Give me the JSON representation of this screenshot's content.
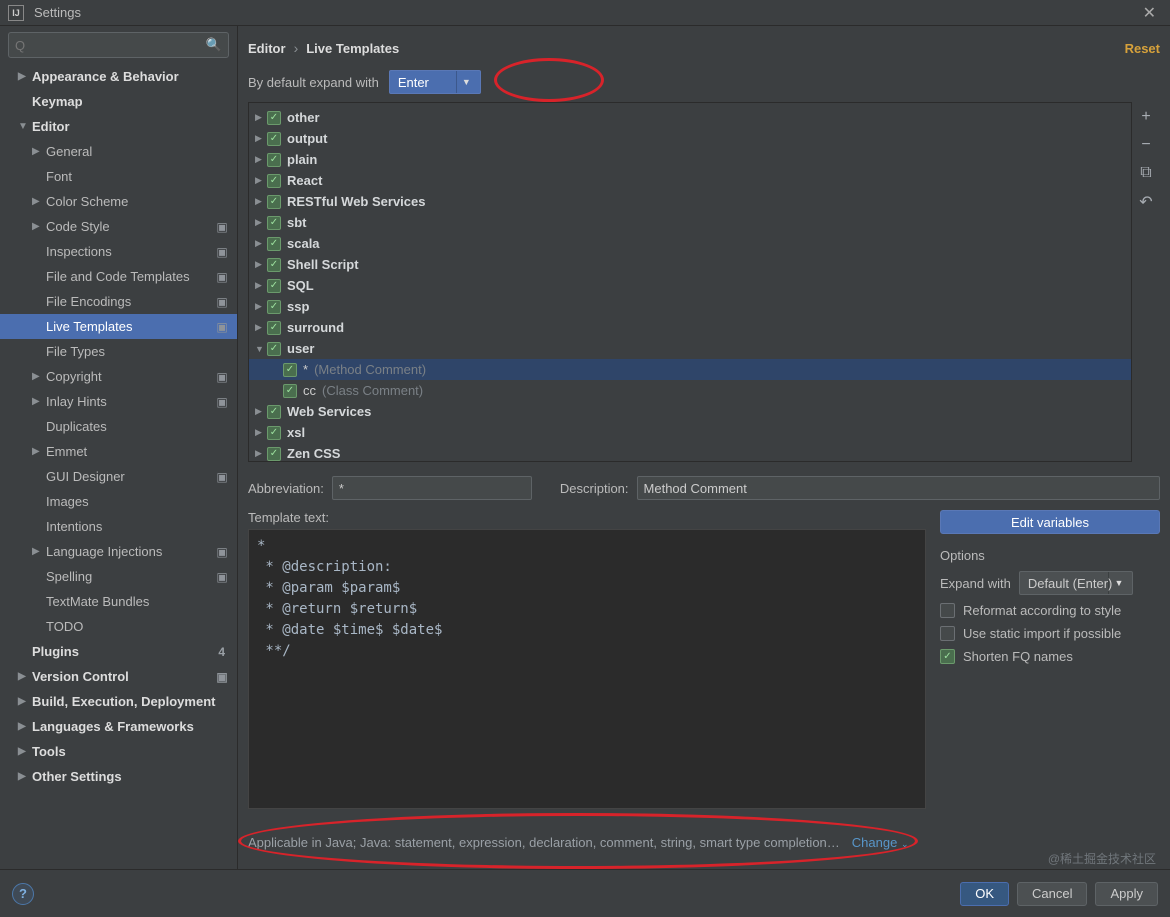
{
  "window": {
    "title": "Settings"
  },
  "search": {
    "placeholder": "Q"
  },
  "breadcrumb": {
    "root": "Editor",
    "page": "Live Templates",
    "reset": "Reset"
  },
  "expand": {
    "label": "By default expand with",
    "value": "Enter"
  },
  "sidebar": {
    "items": [
      {
        "label": "Appearance & Behavior",
        "arrow": "▶",
        "bold": true,
        "lvl": 1
      },
      {
        "label": "Keymap",
        "bold": true,
        "lvl": 1
      },
      {
        "label": "Editor",
        "arrow": "▼",
        "bold": true,
        "lvl": 1
      },
      {
        "label": "General",
        "arrow": "▶",
        "lvl": 2
      },
      {
        "label": "Font",
        "lvl": 2
      },
      {
        "label": "Color Scheme",
        "arrow": "▶",
        "lvl": 2
      },
      {
        "label": "Code Style",
        "arrow": "▶",
        "lvl": 2,
        "badge": true
      },
      {
        "label": "Inspections",
        "lvl": 2,
        "badge": true
      },
      {
        "label": "File and Code Templates",
        "lvl": 2,
        "badge": true
      },
      {
        "label": "File Encodings",
        "lvl": 2,
        "badge": true
      },
      {
        "label": "Live Templates",
        "lvl": 2,
        "selected": true,
        "badge": true
      },
      {
        "label": "File Types",
        "lvl": 2
      },
      {
        "label": "Copyright",
        "arrow": "▶",
        "lvl": 2,
        "badge": true
      },
      {
        "label": "Inlay Hints",
        "arrow": "▶",
        "lvl": 2,
        "badge": true
      },
      {
        "label": "Duplicates",
        "lvl": 2
      },
      {
        "label": "Emmet",
        "arrow": "▶",
        "lvl": 2
      },
      {
        "label": "GUI Designer",
        "lvl": 2,
        "badge": true
      },
      {
        "label": "Images",
        "lvl": 2
      },
      {
        "label": "Intentions",
        "lvl": 2
      },
      {
        "label": "Language Injections",
        "arrow": "▶",
        "lvl": 2,
        "badge": true
      },
      {
        "label": "Spelling",
        "lvl": 2,
        "badge": true
      },
      {
        "label": "TextMate Bundles",
        "lvl": 2
      },
      {
        "label": "TODO",
        "lvl": 2
      },
      {
        "label": "Plugins",
        "bold": true,
        "lvl": 1,
        "count": "4"
      },
      {
        "label": "Version Control",
        "arrow": "▶",
        "bold": true,
        "lvl": 1,
        "badge": true
      },
      {
        "label": "Build, Execution, Deployment",
        "arrow": "▶",
        "bold": true,
        "lvl": 1
      },
      {
        "label": "Languages & Frameworks",
        "arrow": "▶",
        "bold": true,
        "lvl": 1
      },
      {
        "label": "Tools",
        "arrow": "▶",
        "bold": true,
        "lvl": 1
      },
      {
        "label": "Other Settings",
        "arrow": "▶",
        "bold": true,
        "lvl": 1
      }
    ]
  },
  "templates": {
    "groups": [
      {
        "name": "other",
        "arrow": "▶"
      },
      {
        "name": "output",
        "arrow": "▶"
      },
      {
        "name": "plain",
        "arrow": "▶"
      },
      {
        "name": "React",
        "arrow": "▶"
      },
      {
        "name": "RESTful Web Services",
        "arrow": "▶"
      },
      {
        "name": "sbt",
        "arrow": "▶"
      },
      {
        "name": "scala",
        "arrow": "▶"
      },
      {
        "name": "Shell Script",
        "arrow": "▶"
      },
      {
        "name": "SQL",
        "arrow": "▶"
      },
      {
        "name": "ssp",
        "arrow": "▶"
      },
      {
        "name": "surround",
        "arrow": "▶"
      },
      {
        "name": "user",
        "arrow": "▼",
        "children": [
          {
            "abbr": "*",
            "desc": "(Method Comment)",
            "selected": true
          },
          {
            "abbr": "cc",
            "desc": "(Class Comment)"
          }
        ]
      },
      {
        "name": "Web Services",
        "arrow": "▶"
      },
      {
        "name": "xsl",
        "arrow": "▶"
      },
      {
        "name": "Zen CSS",
        "arrow": "▶"
      }
    ]
  },
  "tools": {
    "add": "+",
    "remove": "−",
    "copy": "⧉",
    "undo": "↶"
  },
  "form": {
    "abbr_label": "Abbreviation:",
    "abbr_value": "*",
    "desc_label": "Description:",
    "desc_value": "Method Comment",
    "tpltext_label": "Template text:",
    "template_text": "*\n * @description:\n * @param $param$\n * @return $return$\n * @date $time$ $date$\n **/"
  },
  "options": {
    "edit_vars": "Edit variables",
    "heading": "Options",
    "expand_label": "Expand with",
    "expand_value": "Default (Enter)",
    "reformat": "Reformat according to style",
    "static_import": "Use static import if possible",
    "shorten": "Shorten FQ names"
  },
  "applicable": {
    "text": "Applicable in Java; Java: statement, expression, declaration, comment, string, smart type completion…",
    "change": "Change"
  },
  "buttons": {
    "ok": "OK",
    "cancel": "Cancel",
    "apply": "Apply"
  },
  "watermark": "@稀土掘金技术社区"
}
